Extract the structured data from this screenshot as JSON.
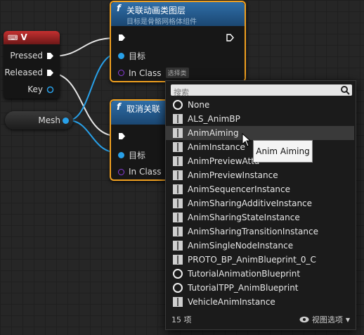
{
  "input_node": {
    "title": "V",
    "pins": [
      "Pressed",
      "Released",
      "Key"
    ]
  },
  "mesh_node": {
    "label": "Mesh"
  },
  "node1": {
    "title": "关联动画类图层",
    "subtitle": "目标是骨骼网格体组件",
    "target_label": "目标",
    "in_class_label": "In Class",
    "class_value": "选择类"
  },
  "node2": {
    "title": "取消关联",
    "target_label": "目标",
    "in_class_label": "In Class"
  },
  "menu": {
    "search_placeholder": "搜索",
    "items": [
      {
        "label": "None",
        "icon": "circle-icon"
      },
      {
        "label": "ALS_AnimBP",
        "icon": "book-icon"
      },
      {
        "label": "AnimAiming",
        "icon": "book-icon"
      },
      {
        "label": "AnimInstance",
        "icon": "book-icon"
      },
      {
        "label": "AnimPreviewAtta",
        "icon": "book-icon"
      },
      {
        "label": "AnimPreviewInstance",
        "icon": "book-icon"
      },
      {
        "label": "AnimSequencerInstance",
        "icon": "book-icon"
      },
      {
        "label": "AnimSharingAdditiveInstance",
        "icon": "book-icon"
      },
      {
        "label": "AnimSharingStateInstance",
        "icon": "book-icon"
      },
      {
        "label": "AnimSharingTransitionInstance",
        "icon": "book-icon"
      },
      {
        "label": "AnimSingleNodeInstance",
        "icon": "book-icon"
      },
      {
        "label": "PROTO_BP_AnimBlueprint_0_C",
        "icon": "book-icon"
      },
      {
        "label": "TutorialAnimationBlueprint",
        "icon": "circle-icon"
      },
      {
        "label": "TutorialTPP_AnimBlueprint",
        "icon": "circle-icon"
      },
      {
        "label": "VehicleAnimInstance",
        "icon": "book-icon"
      }
    ],
    "hovered_index": 2,
    "count_label": "15 项",
    "view_options_label": "视图选项"
  },
  "tooltip": {
    "text": "Anim Aiming"
  },
  "colors": {
    "node_header": "#2f6ea8",
    "selection": "#f0a020",
    "object_pin": "#28a0e8",
    "class_pin": "#8a3dde",
    "input_header": "#c53030"
  }
}
